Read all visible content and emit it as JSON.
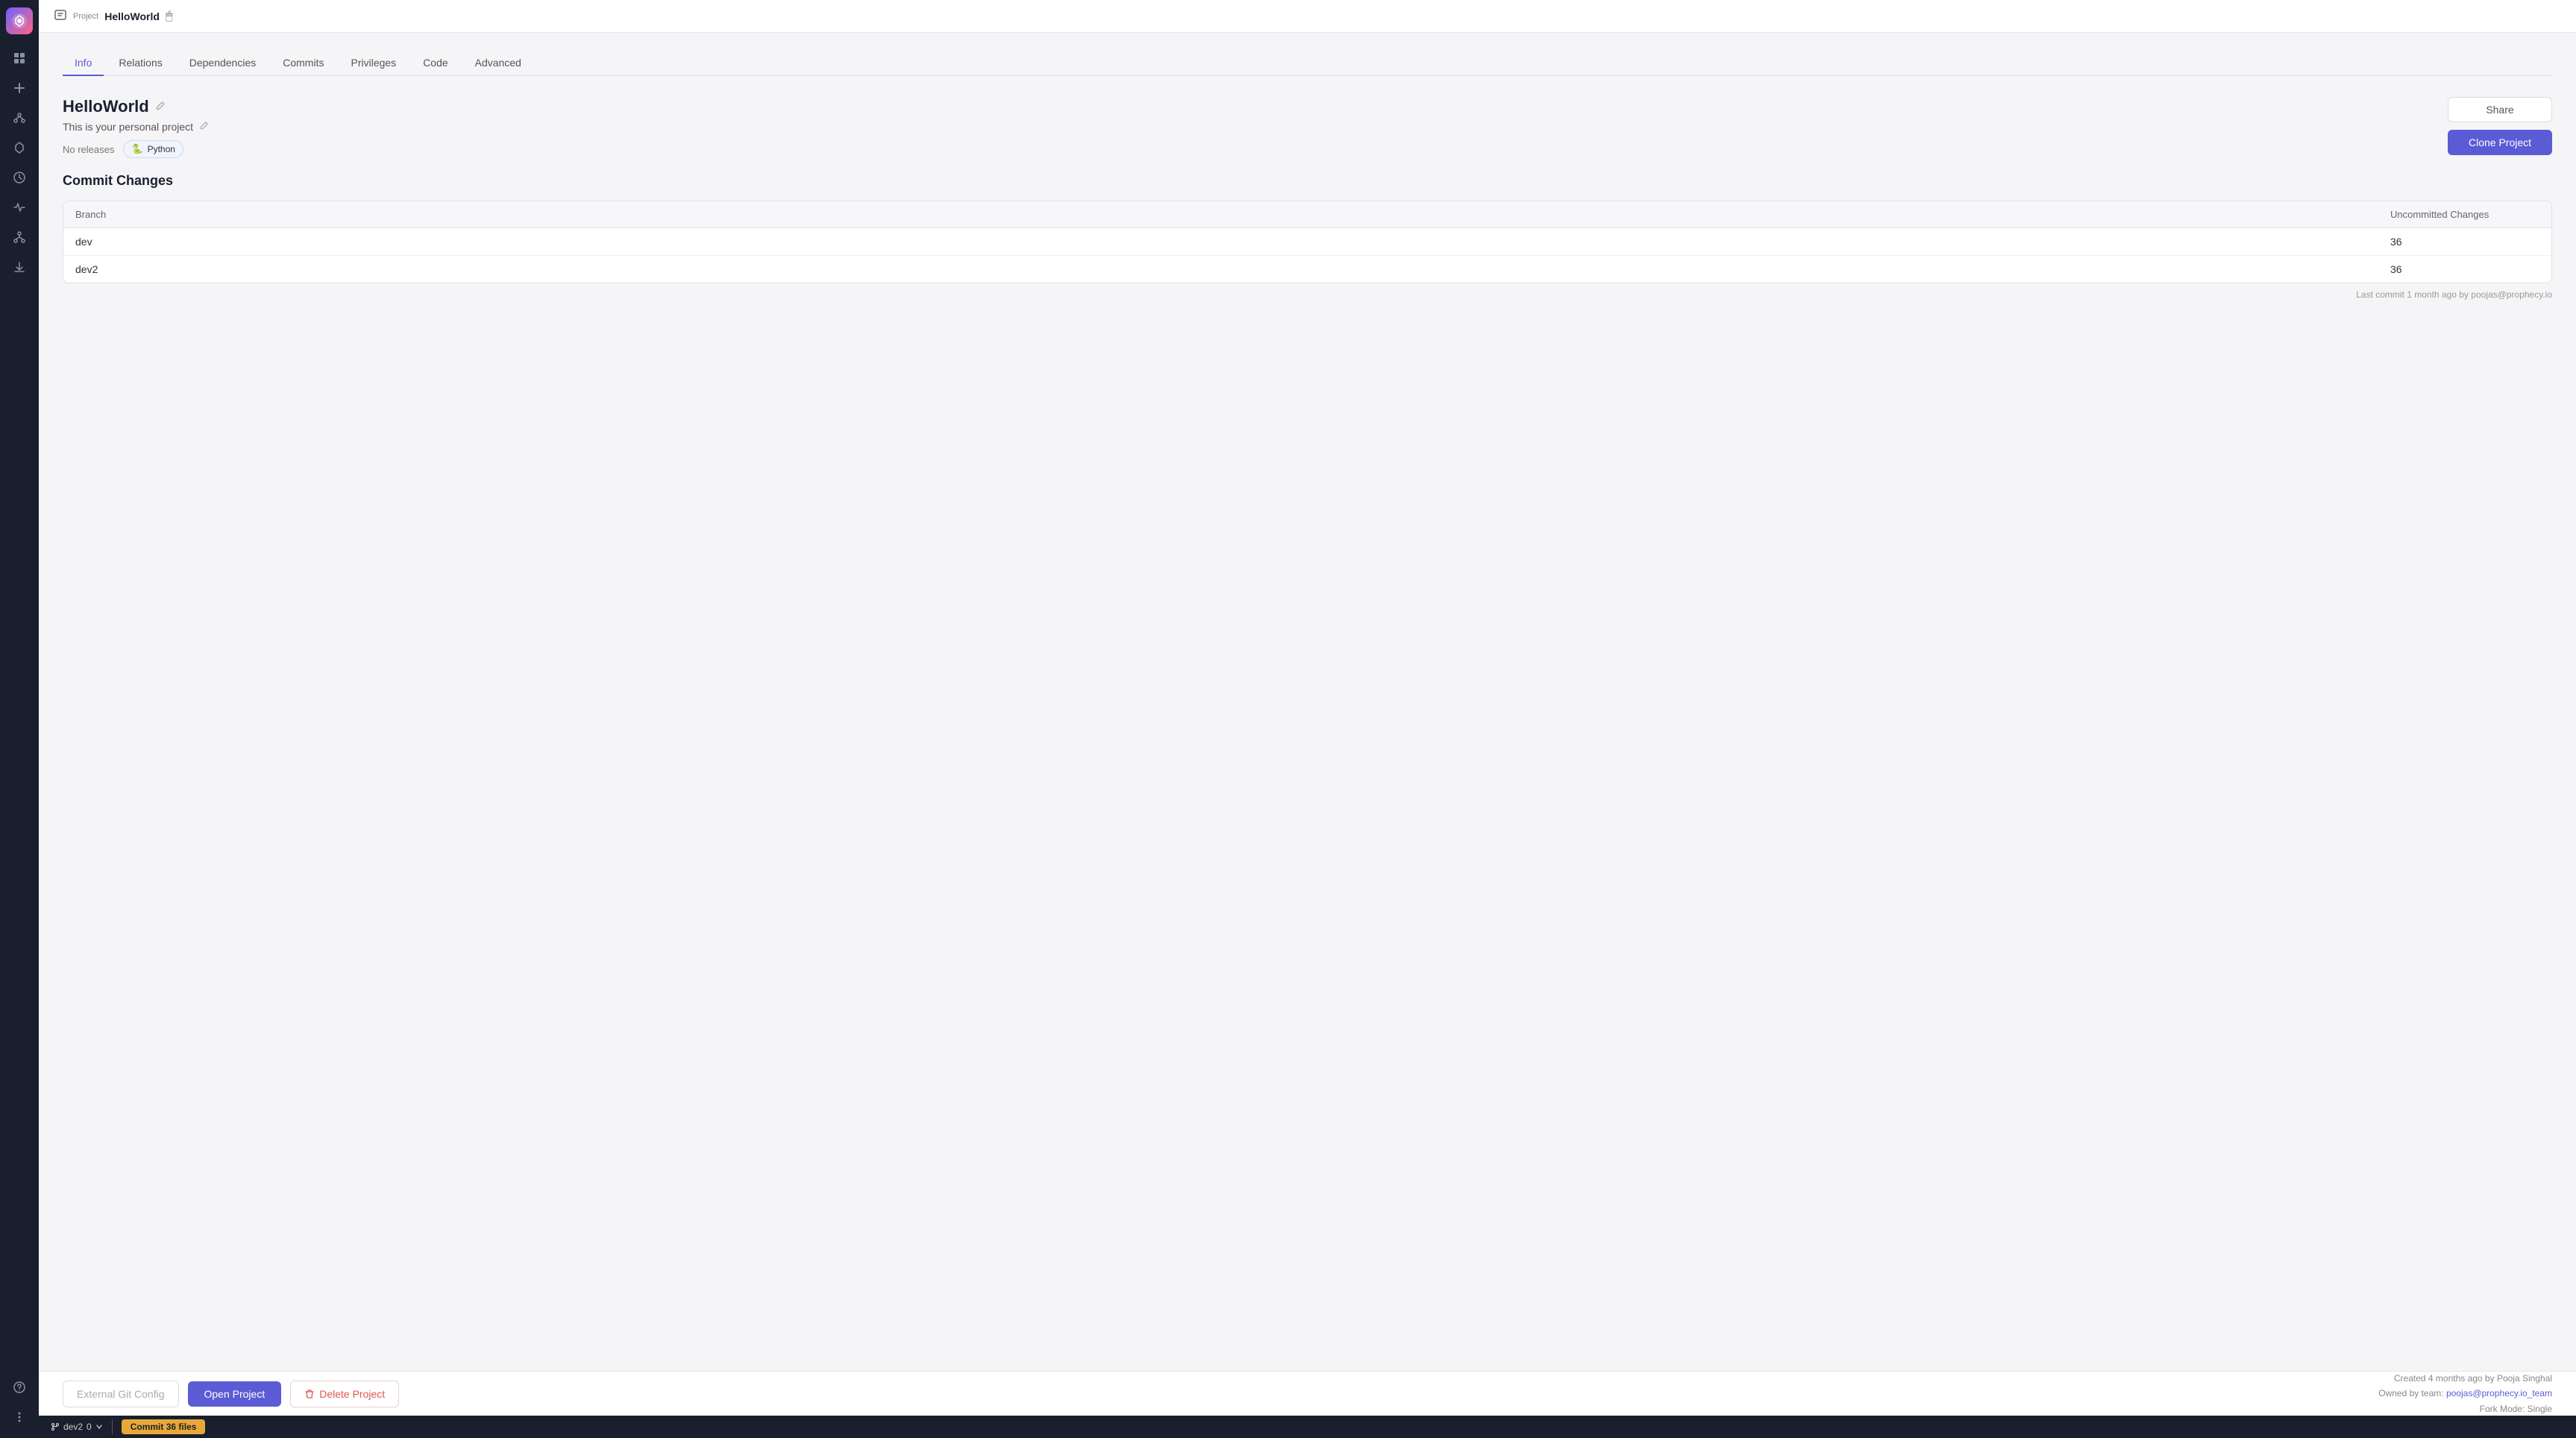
{
  "sidebar": {
    "logo": "P",
    "icons": [
      {
        "name": "home-icon",
        "symbol": "⊞",
        "active": false
      },
      {
        "name": "plus-icon",
        "symbol": "+",
        "active": false
      },
      {
        "name": "graph-icon",
        "symbol": "⬡",
        "active": false
      },
      {
        "name": "gem-icon",
        "symbol": "◈",
        "active": false
      },
      {
        "name": "clock-icon",
        "symbol": "⏱",
        "active": false
      },
      {
        "name": "activity-icon",
        "symbol": "∿",
        "active": false
      },
      {
        "name": "network-icon",
        "symbol": "⛓",
        "active": false
      },
      {
        "name": "download-icon",
        "symbol": "↓",
        "active": false
      }
    ],
    "bottom_icons": [
      {
        "name": "help-icon",
        "symbol": "?"
      },
      {
        "name": "more-icon",
        "symbol": "⋯"
      }
    ]
  },
  "topbar": {
    "project_label": "Project",
    "project_name": "HelloWorld"
  },
  "tabs": [
    {
      "label": "Info",
      "active": true
    },
    {
      "label": "Relations",
      "active": false
    },
    {
      "label": "Dependencies",
      "active": false
    },
    {
      "label": "Commits",
      "active": false
    },
    {
      "label": "Privileges",
      "active": false
    },
    {
      "label": "Code",
      "active": false
    },
    {
      "label": "Advanced",
      "active": false
    }
  ],
  "project": {
    "name": "HelloWorld",
    "description": "This is your personal project",
    "releases": "No releases",
    "language_badge": "🐍 Python",
    "share_label": "Share",
    "clone_label": "Clone Project"
  },
  "commit_changes": {
    "section_title": "Commit Changes",
    "table": {
      "headers": [
        "Branch",
        "Uncommitted Changes"
      ],
      "rows": [
        {
          "branch": "dev",
          "uncommitted": "36"
        },
        {
          "branch": "dev2",
          "uncommitted": "36"
        }
      ]
    },
    "footer": "Last commit 1 month ago by poojas@prophecy.io"
  },
  "bottom_bar": {
    "external_git_label": "External Git Config",
    "open_project_label": "Open Project",
    "delete_project_label": "Delete Project",
    "meta": {
      "created": "Created 4 months ago by Pooja Singhal",
      "owned_by": "Owned by team:",
      "team_link": "poojas@prophecy.io_team",
      "fork_mode": "Fork Mode: Single"
    }
  },
  "statusbar": {
    "branch": "dev2",
    "count": "0",
    "commit_label": "Commit 36 files"
  }
}
